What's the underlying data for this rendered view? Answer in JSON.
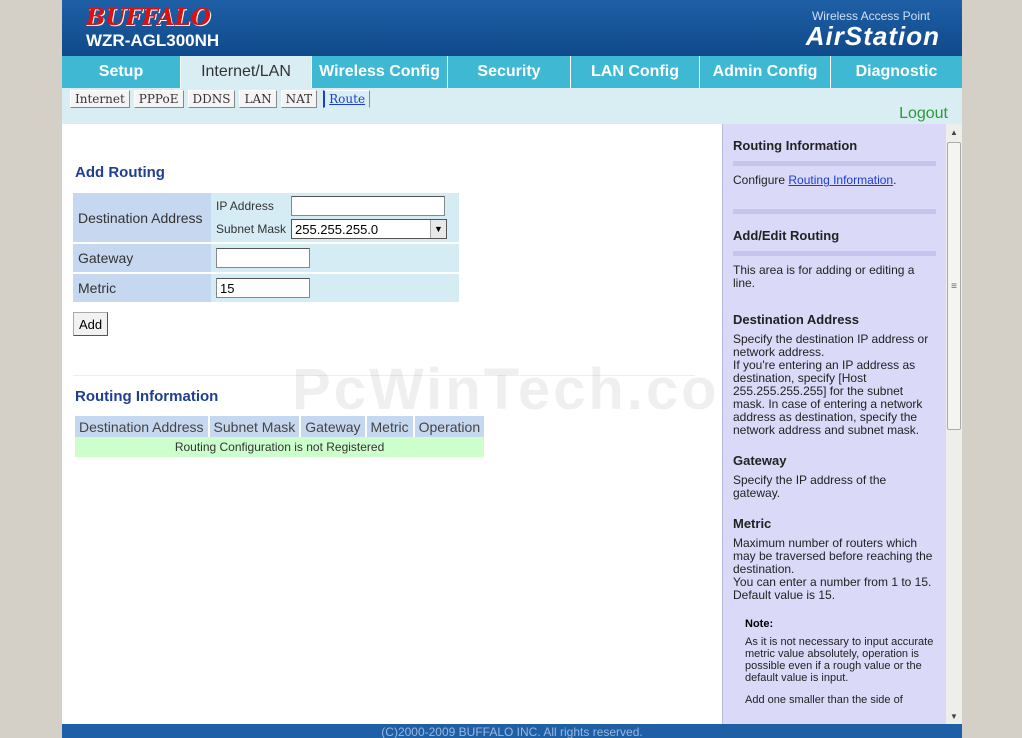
{
  "header": {
    "brand": "BUFFALO",
    "model": "WZR-AGL300NH",
    "product_sub": "Wireless Access Point",
    "product_name": "AirStation"
  },
  "tabs": [
    {
      "label": "Setup",
      "active": false
    },
    {
      "label": "Internet/LAN",
      "active": true
    },
    {
      "label": "Wireless Config",
      "active": false
    },
    {
      "label": "Security",
      "active": false
    },
    {
      "label": "LAN Config",
      "active": false
    },
    {
      "label": "Admin Config",
      "active": false
    },
    {
      "label": "Diagnostic",
      "active": false
    }
  ],
  "subtabs": [
    {
      "label": "Internet",
      "active": false
    },
    {
      "label": "PPPoE",
      "active": false
    },
    {
      "label": "DDNS",
      "active": false
    },
    {
      "label": "LAN",
      "active": false
    },
    {
      "label": "NAT",
      "active": false
    },
    {
      "label": "Route",
      "active": true
    }
  ],
  "logout_label": "Logout",
  "add_routing": {
    "title": "Add Routing",
    "destination_label": "Destination Address",
    "ip_label": "IP Address",
    "ip_value": "",
    "mask_label": "Subnet Mask",
    "mask_value": "255.255.255.0",
    "gateway_label": "Gateway",
    "gateway_value": "",
    "metric_label": "Metric",
    "metric_value": "15",
    "add_button": "Add"
  },
  "routing_info": {
    "title": "Routing Information",
    "columns": [
      "Destination Address",
      "Subnet Mask",
      "Gateway",
      "Metric",
      "Operation"
    ],
    "empty_message": "Routing Configuration is not Registered"
  },
  "help": {
    "title": "Routing Information",
    "configure_prefix": "Configure ",
    "configure_link": "Routing Information",
    "configure_suffix": ".",
    "add_edit_title": "Add/Edit Routing",
    "add_edit_text": "This area is for adding or editing a line.",
    "dest_title": "Destination Address",
    "dest_text": "Specify the destination IP address or network address.",
    "dest_text2": "If you're entering an IP address as destination, specify [Host 255.255.255.255] for the subnet mask. In case of entering a network address as destination, specify the network address and subnet mask.",
    "gateway_title": "Gateway",
    "gateway_text": "Specify the IP address of the gateway.",
    "metric_title": "Metric",
    "metric_text": "Maximum number of routers which may be traversed before reaching the destination.",
    "metric_text2": "You can enter a number from 1 to 15. Default value is 15.",
    "note_title": "Note:",
    "note_text": "As it is not necessary to input accurate metric value absolutely, operation is possible even if a rough value or the default value is input.",
    "note_text2": "Add one smaller than the side of"
  },
  "footer": "(C)2000-2009 BUFFALO INC. All rights reserved.",
  "watermark": "PcWinTech.com",
  "colors": {
    "header_blue": "#1f5fa6",
    "tab_cyan": "#3fb8d4",
    "help_bg": "#dadaf8",
    "logout_green": "#2a9a3a",
    "empty_row_green": "#ccffcc"
  }
}
